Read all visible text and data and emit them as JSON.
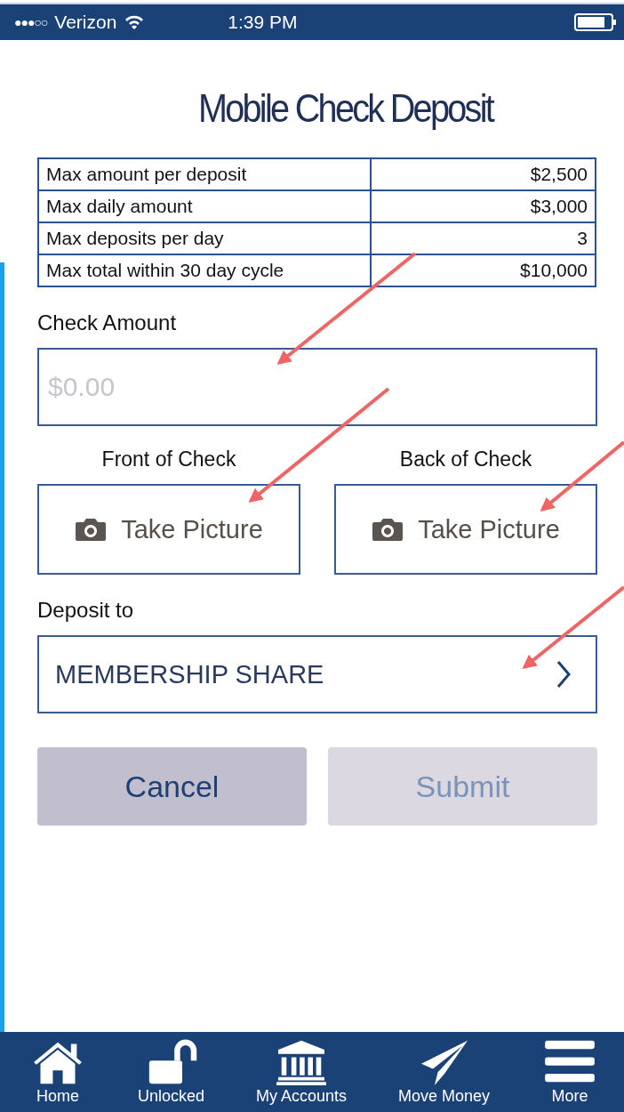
{
  "status_bar": {
    "signal": "●●●○○",
    "carrier": "Verizon",
    "time": "1:39 PM"
  },
  "title": "Mobile Check Deposit",
  "limits": [
    {
      "label": "Max amount per deposit",
      "value": "$2,500"
    },
    {
      "label": "Max daily amount",
      "value": "$3,000"
    },
    {
      "label": "Max deposits per day",
      "value": "3"
    },
    {
      "label": "Max total within 30 day cycle",
      "value": "$10,000"
    }
  ],
  "check_amount": {
    "label": "Check Amount",
    "placeholder": "$0.00"
  },
  "photos": [
    {
      "label": "Front of Check",
      "button": "Take Picture"
    },
    {
      "label": "Back of Check",
      "button": "Take Picture"
    }
  ],
  "deposit_to": {
    "label": "Deposit to",
    "value": "MEMBERSHIP SHARE"
  },
  "buttons": [
    {
      "label": "Cancel",
      "disabled": false
    },
    {
      "label": "Submit",
      "disabled": true
    }
  ],
  "tab_bar": [
    {
      "kind": "home",
      "label": "Home"
    },
    {
      "kind": "lock",
      "label": "Unlocked"
    },
    {
      "kind": "bank",
      "label": "My Accounts"
    },
    {
      "kind": "send",
      "label": "Move Money"
    },
    {
      "kind": "menu",
      "label": "More"
    }
  ]
}
